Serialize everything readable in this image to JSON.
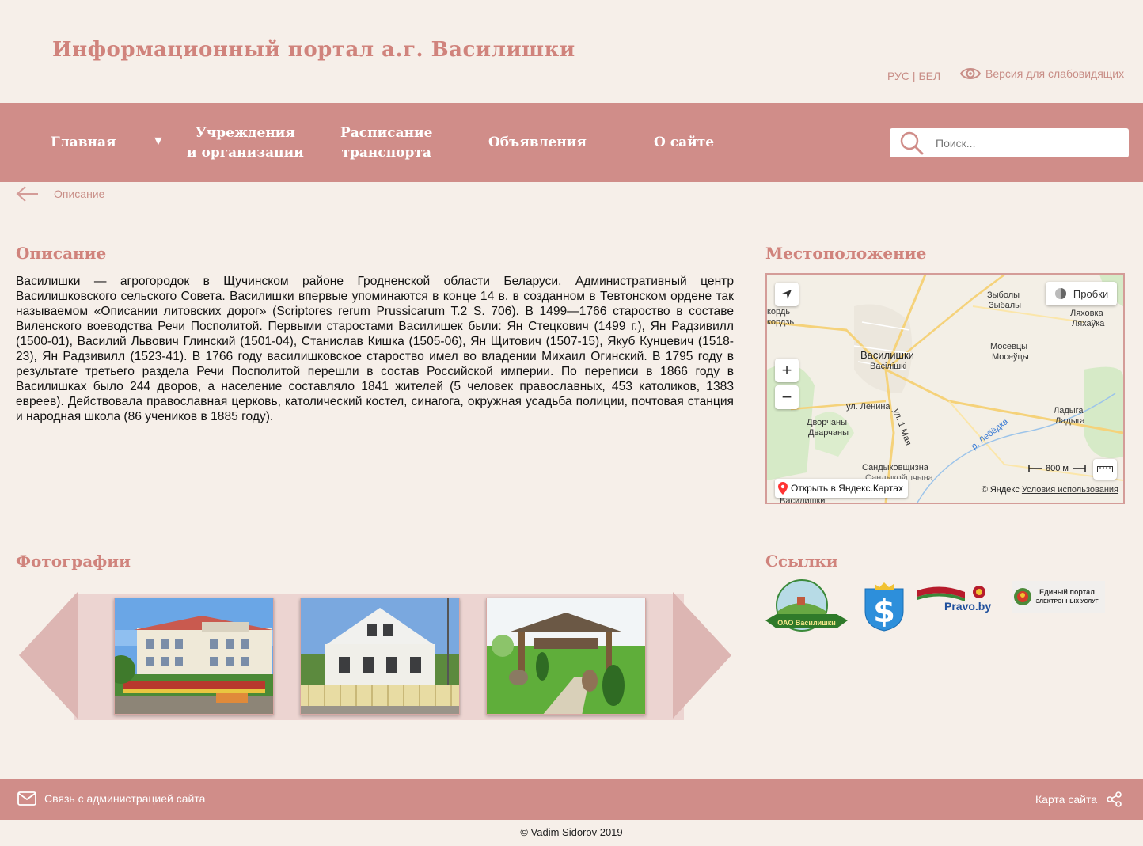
{
  "header": {
    "title": "Информационный портал а.г. Василишки",
    "lang": "РУС | БЕЛ",
    "vision_label": "Версия для слабовидящих"
  },
  "nav": {
    "items": [
      {
        "label": "Главная"
      },
      {
        "label": "Учреждения\nи организации"
      },
      {
        "label": "Расписание\nтранспорта"
      },
      {
        "label": "Объявления"
      },
      {
        "label": "О сайте"
      }
    ],
    "search_placeholder": "Поиск..."
  },
  "breadcrumb": {
    "current": "Описание"
  },
  "description": {
    "heading": "Описание",
    "text": "Василишки — агрогородок в Щучинском районе Гродненской области Беларуси. Административный центр Василишковского сельского Совета. Василишки впервые упоминаются в конце 14 в. в созданном в Тевтонском ордене так называемом «Описании литовских дорог» (Scriptores rerum Prussicarum T.2 S. 706). В 1499—1766 староство в составе Виленского воеводства Речи Посполитой. Первыми старостами Василишек были: Ян Стецкович (1499 г.), Ян Радзивилл (1500-01), Василий Львович Глинский (1501-04), Станислав Кишка (1505-06), Ян Щитович (1507-15), Якуб Кунцевич (1518-23), Ян Радзивилл (1523-41). В 1766 году василишковское староство имел во владении Михаил Огинский. В 1795 году в результате третьего раздела Речи Посполитой перешли в состав Российской империи. По переписи в 1866 году в Василишках было 244 дворов, а население составляло 1841 жителей (5 человек православных, 453 католиков, 1383 евреев). Действовала православная церковь, католический костел, синагога, окружная усадьба полиции, почтовая станция и народная школа (86 учеников в 1885 году)."
  },
  "location": {
    "heading": "Местоположение",
    "map": {
      "traffic_label": "Пробки",
      "open_label": "Открыть в Яндекс.Картах",
      "copyright": "© Яндекс",
      "terms": "Условия использования",
      "scale": "800 м",
      "labels": {
        "vasilishki": "Василишки",
        "vasilishki_by": "Васілішкі",
        "zybaly": "Зыболы",
        "zybaly_by": "Зыбалы",
        "lyakhovka": "Ляховка",
        "lyakhovka_by": "Ляхаўка",
        "mosevtsy": "Мосевцы",
        "mosevtsy_by": "Мосеўцы",
        "dvorchany": "Дворчаны",
        "dvorchany_by": "Дварчаны",
        "ladyga": "Ладыга",
        "ladyga_by": "Ладыга",
        "sandykovshchina": "Сандыковщизна",
        "sandykovshchina_by": "Сандыкоўшчына",
        "lenina": "ул. Ленина",
        "maya": "ул. 1 Мая",
        "lebedka": "р. Лебёдка",
        "kordz": "кордь",
        "kordz_by": "кордзь",
        "vasilishki_bottom": "Василишки"
      }
    }
  },
  "photos": {
    "heading": "Фотографии"
  },
  "links": {
    "heading": "Ссылки",
    "ooo_label": "ОАО Василишки",
    "pravo_label": "Pravo.by",
    "portal_label_line1": "Единый портал",
    "portal_label_line2": "электронных услуг"
  },
  "footer": {
    "contact": "Связь с администрацией сайта",
    "sitemap": "Карта сайта",
    "copyright": "© Vadim Sidorov 2019"
  },
  "colors": {
    "accent": "#d08d89",
    "title": "#d0837c",
    "background": "#f6efe9"
  }
}
